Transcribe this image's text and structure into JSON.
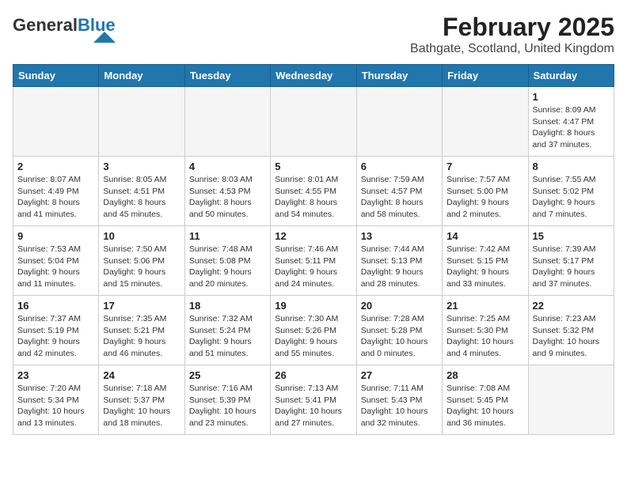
{
  "logo": {
    "general": "General",
    "blue": "Blue"
  },
  "title": "February 2025",
  "subtitle": "Bathgate, Scotland, United Kingdom",
  "weekdays": [
    "Sunday",
    "Monday",
    "Tuesday",
    "Wednesday",
    "Thursday",
    "Friday",
    "Saturday"
  ],
  "weeks": [
    [
      {
        "day": "",
        "info": ""
      },
      {
        "day": "",
        "info": ""
      },
      {
        "day": "",
        "info": ""
      },
      {
        "day": "",
        "info": ""
      },
      {
        "day": "",
        "info": ""
      },
      {
        "day": "",
        "info": ""
      },
      {
        "day": "1",
        "info": "Sunrise: 8:09 AM\nSunset: 4:47 PM\nDaylight: 8 hours and 37 minutes."
      }
    ],
    [
      {
        "day": "2",
        "info": "Sunrise: 8:07 AM\nSunset: 4:49 PM\nDaylight: 8 hours and 41 minutes."
      },
      {
        "day": "3",
        "info": "Sunrise: 8:05 AM\nSunset: 4:51 PM\nDaylight: 8 hours and 45 minutes."
      },
      {
        "day": "4",
        "info": "Sunrise: 8:03 AM\nSunset: 4:53 PM\nDaylight: 8 hours and 50 minutes."
      },
      {
        "day": "5",
        "info": "Sunrise: 8:01 AM\nSunset: 4:55 PM\nDaylight: 8 hours and 54 minutes."
      },
      {
        "day": "6",
        "info": "Sunrise: 7:59 AM\nSunset: 4:57 PM\nDaylight: 8 hours and 58 minutes."
      },
      {
        "day": "7",
        "info": "Sunrise: 7:57 AM\nSunset: 5:00 PM\nDaylight: 9 hours and 2 minutes."
      },
      {
        "day": "8",
        "info": "Sunrise: 7:55 AM\nSunset: 5:02 PM\nDaylight: 9 hours and 7 minutes."
      }
    ],
    [
      {
        "day": "9",
        "info": "Sunrise: 7:53 AM\nSunset: 5:04 PM\nDaylight: 9 hours and 11 minutes."
      },
      {
        "day": "10",
        "info": "Sunrise: 7:50 AM\nSunset: 5:06 PM\nDaylight: 9 hours and 15 minutes."
      },
      {
        "day": "11",
        "info": "Sunrise: 7:48 AM\nSunset: 5:08 PM\nDaylight: 9 hours and 20 minutes."
      },
      {
        "day": "12",
        "info": "Sunrise: 7:46 AM\nSunset: 5:11 PM\nDaylight: 9 hours and 24 minutes."
      },
      {
        "day": "13",
        "info": "Sunrise: 7:44 AM\nSunset: 5:13 PM\nDaylight: 9 hours and 28 minutes."
      },
      {
        "day": "14",
        "info": "Sunrise: 7:42 AM\nSunset: 5:15 PM\nDaylight: 9 hours and 33 minutes."
      },
      {
        "day": "15",
        "info": "Sunrise: 7:39 AM\nSunset: 5:17 PM\nDaylight: 9 hours and 37 minutes."
      }
    ],
    [
      {
        "day": "16",
        "info": "Sunrise: 7:37 AM\nSunset: 5:19 PM\nDaylight: 9 hours and 42 minutes."
      },
      {
        "day": "17",
        "info": "Sunrise: 7:35 AM\nSunset: 5:21 PM\nDaylight: 9 hours and 46 minutes."
      },
      {
        "day": "18",
        "info": "Sunrise: 7:32 AM\nSunset: 5:24 PM\nDaylight: 9 hours and 51 minutes."
      },
      {
        "day": "19",
        "info": "Sunrise: 7:30 AM\nSunset: 5:26 PM\nDaylight: 9 hours and 55 minutes."
      },
      {
        "day": "20",
        "info": "Sunrise: 7:28 AM\nSunset: 5:28 PM\nDaylight: 10 hours and 0 minutes."
      },
      {
        "day": "21",
        "info": "Sunrise: 7:25 AM\nSunset: 5:30 PM\nDaylight: 10 hours and 4 minutes."
      },
      {
        "day": "22",
        "info": "Sunrise: 7:23 AM\nSunset: 5:32 PM\nDaylight: 10 hours and 9 minutes."
      }
    ],
    [
      {
        "day": "23",
        "info": "Sunrise: 7:20 AM\nSunset: 5:34 PM\nDaylight: 10 hours and 13 minutes."
      },
      {
        "day": "24",
        "info": "Sunrise: 7:18 AM\nSunset: 5:37 PM\nDaylight: 10 hours and 18 minutes."
      },
      {
        "day": "25",
        "info": "Sunrise: 7:16 AM\nSunset: 5:39 PM\nDaylight: 10 hours and 23 minutes."
      },
      {
        "day": "26",
        "info": "Sunrise: 7:13 AM\nSunset: 5:41 PM\nDaylight: 10 hours and 27 minutes."
      },
      {
        "day": "27",
        "info": "Sunrise: 7:11 AM\nSunset: 5:43 PM\nDaylight: 10 hours and 32 minutes."
      },
      {
        "day": "28",
        "info": "Sunrise: 7:08 AM\nSunset: 5:45 PM\nDaylight: 10 hours and 36 minutes."
      },
      {
        "day": "",
        "info": ""
      }
    ]
  ]
}
